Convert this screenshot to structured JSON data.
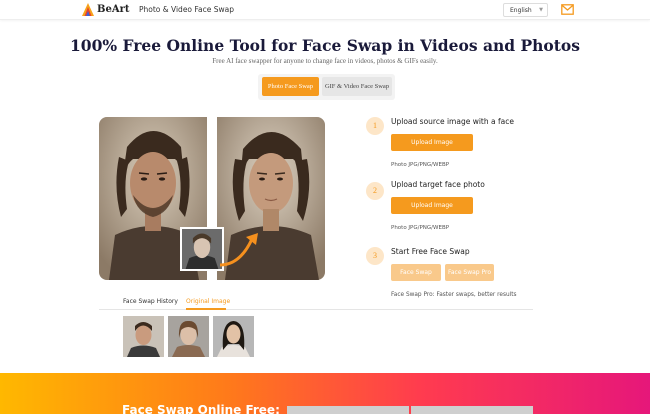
{
  "header": {
    "brand": "BeArt",
    "nav_label": "Photo & Video Face Swap",
    "language": "English",
    "icons": {
      "logo": "beart-logo-icon",
      "mail": "mail-icon",
      "chevron": "chevron-down-icon"
    }
  },
  "hero": {
    "title": "100% Free Online Tool for Face Swap in Videos and Photos",
    "subtitle": "Free AI face swapper for anyone to change face in videos, photos & GIFs easily.",
    "tabs": [
      {
        "label": "Photo Face Swap",
        "active": true
      },
      {
        "label": "GIF & Video Face Swap",
        "active": false
      }
    ]
  },
  "steps": [
    {
      "number": "1",
      "title": "Upload source image with a face",
      "button": "Upload Image",
      "formats": "Photo JPG/PNG/WEBP"
    },
    {
      "number": "2",
      "title": "Upload target face photo",
      "button": "Upload Image",
      "formats": "Photo JPG/PNG/WEBP"
    },
    {
      "number": "3",
      "title": "Start Free Face Swap",
      "buttons": [
        "Face Swap",
        "Face Swap Pro"
      ],
      "note": "Face Swap Pro: Faster swaps, better results"
    }
  ],
  "history": {
    "tabs": [
      {
        "label": "Face Swap History",
        "active": false
      },
      {
        "label": "Original Image",
        "active": true
      }
    ]
  },
  "banner": {
    "title": "Face Swap Online Free:"
  },
  "colors": {
    "accent": "#f59a1e",
    "accent_light": "#f9c98b",
    "step_circle": "#fde6c8",
    "title": "#1a1a3a"
  }
}
